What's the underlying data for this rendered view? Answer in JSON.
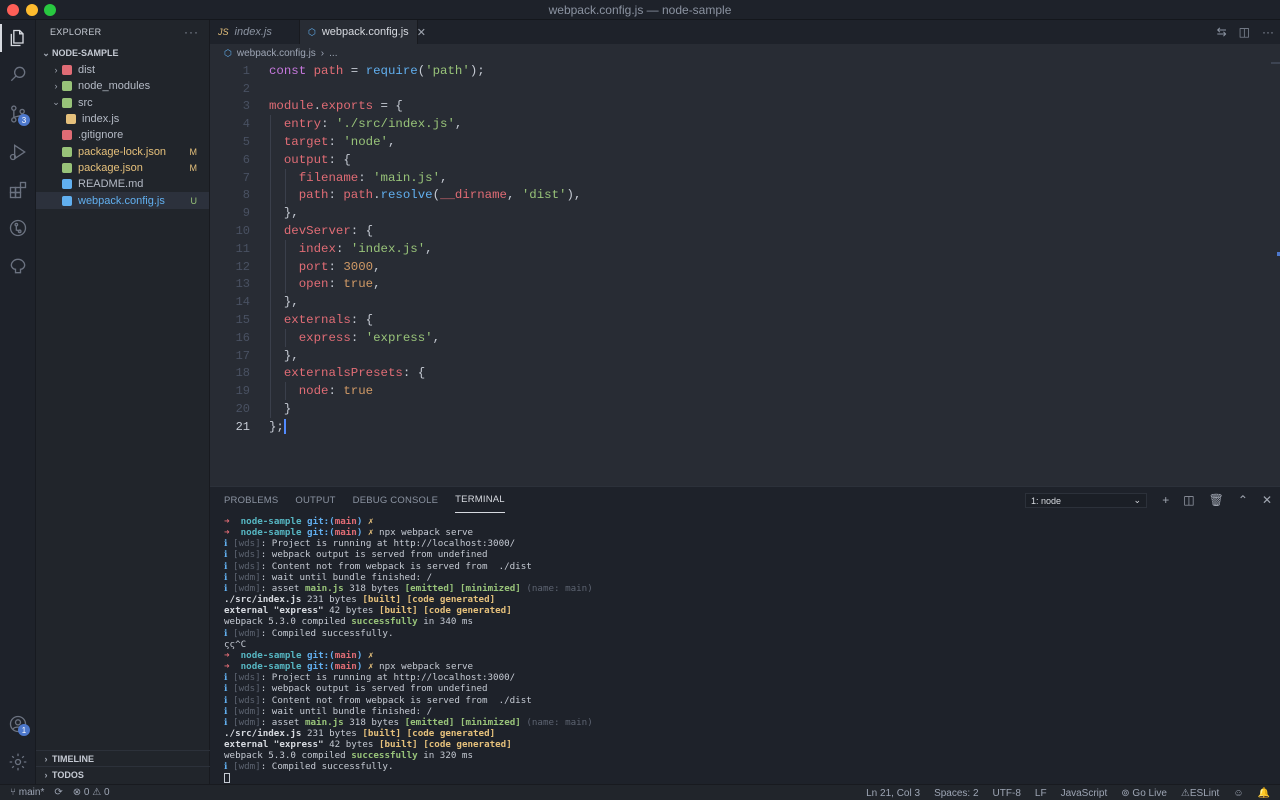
{
  "window": {
    "title": "webpack.config.js — node-sample"
  },
  "activity": {
    "scm_badge": "3",
    "accounts_badge": "1"
  },
  "explorer": {
    "header": "EXPLORER",
    "more": "···",
    "folder": "NODE-SAMPLE",
    "items": [
      {
        "label": "dist",
        "type": "folder",
        "expanded": false,
        "color": "#e06c75"
      },
      {
        "label": "node_modules",
        "type": "folder",
        "expanded": false,
        "color": "#98c379"
      },
      {
        "label": "src",
        "type": "folder",
        "expanded": true,
        "color": "#98c379"
      },
      {
        "label": "index.js",
        "type": "file",
        "color": "#e5c07b"
      },
      {
        "label": ".gitignore",
        "type": "file",
        "color": "#e06c75"
      },
      {
        "label": "package-lock.json",
        "type": "file",
        "color": "#98c379",
        "badge": "M"
      },
      {
        "label": "package.json",
        "type": "file",
        "color": "#98c379",
        "badge": "M"
      },
      {
        "label": "README.md",
        "type": "file",
        "color": "#61afef"
      },
      {
        "label": "webpack.config.js",
        "type": "file",
        "color": "#61afef",
        "badge": "U"
      }
    ],
    "timeline": "TIMELINE",
    "todos": "TODOS"
  },
  "tabs": [
    {
      "label": "index.js",
      "icon": "JS"
    },
    {
      "label": "webpack.config.js",
      "icon": "⬡",
      "close": "✕"
    }
  ],
  "breadcrumb": {
    "file": "webpack.config.js",
    "sep": "›",
    "more": "..."
  },
  "editor": {
    "line_numbers": [
      "1",
      "2",
      "3",
      "4",
      "5",
      "6",
      "7",
      "8",
      "9",
      "10",
      "11",
      "12",
      "13",
      "14",
      "15",
      "16",
      "17",
      "18",
      "19",
      "20",
      "21"
    ]
  },
  "panel": {
    "tabs": [
      "PROBLEMS",
      "OUTPUT",
      "DEBUG CONSOLE",
      "TERMINAL"
    ],
    "terminal_select": "1: node",
    "add": "+",
    "split": "◫",
    "trash": "🗑",
    "maximize": "⌃",
    "close": "✕"
  },
  "terminal": {
    "prompt_dir": "node-sample",
    "git": "git:(",
    "branch": "main",
    "git_close": ")",
    "dirty": "✗",
    "cmd": "npx webpack serve",
    "wds1": "Project is running at http://localhost:3000/",
    "wds2": "webpack output is served from undefined",
    "wds3": "Content not from webpack is served from  ./dist",
    "wdm1": "wait until bundle finished: /",
    "wdm_asset": "main.js",
    "asset_size": "318 bytes",
    "emitted": "[emitted]",
    "minimized": "[minimized]",
    "name_main": "(name: main)",
    "src_module": "./src/index.js",
    "src_size": "231 bytes",
    "built": "[built]",
    "codegen": "[code generated]",
    "ext_module": "external \"express\"",
    "ext_size": "42 bytes",
    "compiled_pre": "webpack 5.3.0 compiled",
    "successfully": "successfully",
    "time1": "in 340 ms",
    "time2": "in 320 ms",
    "wdm2": "Compiled successfully.",
    "ctrlc": "ςς^C",
    "tag_wds": "[wds]",
    "tag_wdm": "[wdm]",
    "info": "ℹ",
    "arrow": "➜"
  },
  "statusbar": {
    "branch": "main*",
    "sync": "⟳",
    "errors": "0",
    "warnings": "0",
    "position": "Ln 21, Col 3",
    "spaces": "Spaces: 2",
    "encoding": "UTF-8",
    "eol": "LF",
    "language": "JavaScript",
    "golive": "Go Live",
    "eslint": "ESLint"
  }
}
